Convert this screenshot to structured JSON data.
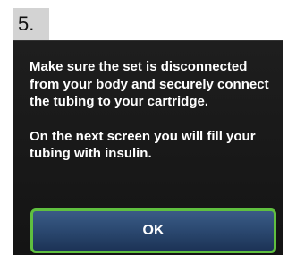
{
  "step": {
    "number": "5."
  },
  "dialog": {
    "paragraph_1": "Make sure the set is disconnected from your body and securely connect the tubing to your cartridge.",
    "paragraph_2": "On the next screen you will fill your tubing with insulin.",
    "ok_label": "OK"
  },
  "colors": {
    "screen_background": "#1a1a1a",
    "button_border": "#5fbf3f",
    "button_fill": "#2c4a72",
    "step_tab": "#d3d3d3"
  }
}
